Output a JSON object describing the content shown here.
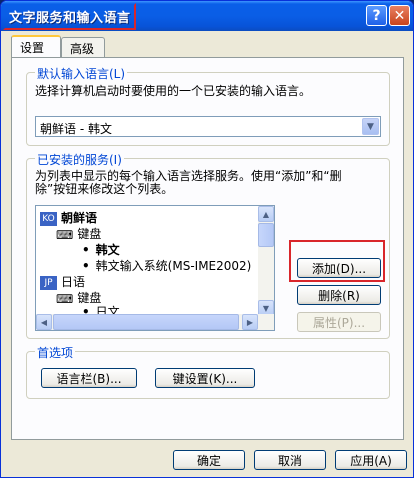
{
  "window": {
    "title": "文字服务和输入语言",
    "help_glyph": "?",
    "close_glyph": "✕"
  },
  "tabs": [
    {
      "label": "设置",
      "active": true
    },
    {
      "label": "高级",
      "active": false
    }
  ],
  "default_lang": {
    "group_title": "默认输入语言(L)",
    "description": "选择计算机启动时要使用的一个已安装的输入语言。",
    "selected": "朝鲜语 - 韩文"
  },
  "installed": {
    "group_title": "已安装的服务(I)",
    "description_line1": "为列表中显示的每个输入语言选择服务。使用“添加”和“删",
    "description_line2": "除”按钮来修改这个列表。",
    "tree": [
      {
        "type": "lang",
        "badge": "KO",
        "label": "朝鲜语",
        "bold": true
      },
      {
        "type": "category",
        "label": "键盘"
      },
      {
        "type": "service",
        "label": "韩文",
        "bold": true
      },
      {
        "type": "service",
        "label": "韩文输入系统(MS-IME2002)"
      },
      {
        "type": "lang",
        "badge": "JP",
        "label": "日语"
      },
      {
        "type": "category",
        "label": "键盘"
      },
      {
        "type": "service",
        "label": "日文"
      }
    ],
    "buttons": {
      "add": "添加(D)...",
      "remove": "删除(R)",
      "properties": "属性(P)..."
    }
  },
  "preferences": {
    "group_title": "首选项",
    "language_bar": "语言栏(B)...",
    "key_settings": "键设置(K)..."
  },
  "footer": {
    "ok": "确定",
    "cancel": "取消",
    "apply": "应用(A)"
  },
  "colors": {
    "titlebar": "#0a5ee6",
    "highlight": "#d9262b",
    "group_title": "#0046d5"
  }
}
